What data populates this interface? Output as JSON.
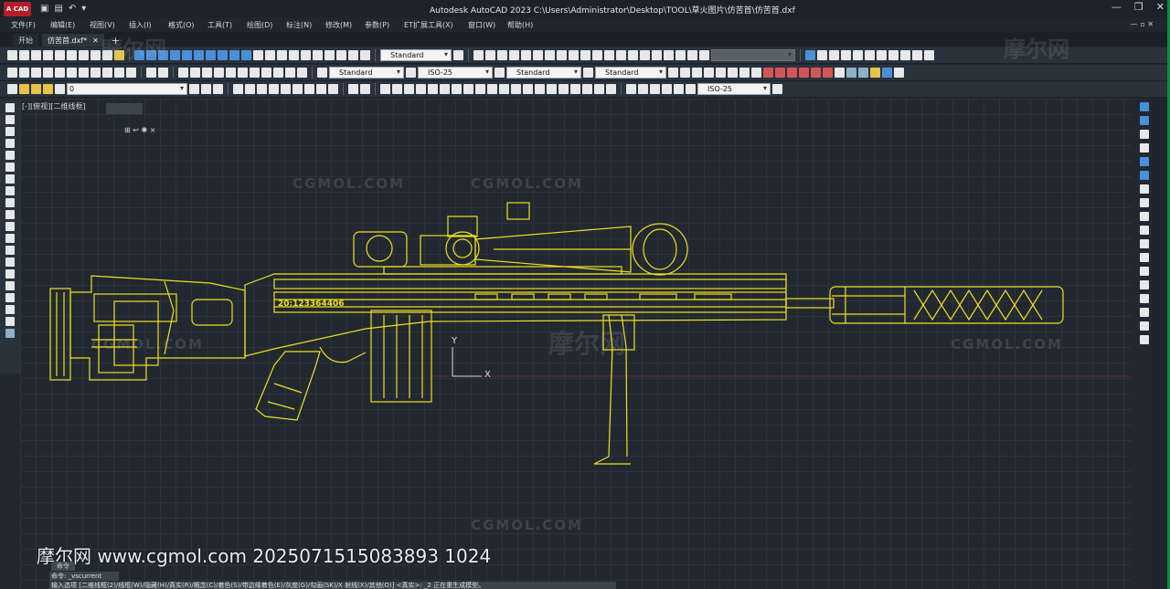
{
  "title_bar": {
    "app_badge": "A CAD",
    "title": "Autodesk AutoCAD 2023    C:\\Users\\Administrator\\Desktop\\TOOL\\草火图片\\仿苦首\\仿苦首.dxf",
    "qat_icons": [
      "open-icon",
      "save-icon",
      "undo-icon",
      "customize-icon"
    ],
    "min_glyph": "—",
    "restore_glyph": "❐",
    "close_glyph": "✕"
  },
  "menu": {
    "items": [
      "文件(F)",
      "编辑(E)",
      "视图(V)",
      "插入(I)",
      "格式(O)",
      "工具(T)",
      "绘图(D)",
      "标注(N)",
      "修改(M)",
      "参数(P)",
      "ET扩展工具(X)",
      "窗口(W)",
      "帮助(H)"
    ],
    "right_glyph": "— ▫ ✕"
  },
  "file_tabs": {
    "items": [
      {
        "label": "开始",
        "close": ""
      },
      {
        "label": "仿苦首.dxf*",
        "close": "✕"
      }
    ],
    "add_glyph": "+"
  },
  "toolbar": {
    "text_style": "Standard",
    "layer_search": "",
    "annot_style": "Standard",
    "dim_style": "ISO-25",
    "table_style": "Standard",
    "multileader_style": "Standard",
    "layer": "0",
    "dim_style2": "ISO-25"
  },
  "viewport": {
    "label": "[-][俯视][二维线框]",
    "nav_glyphs": "⊞ ↩ ✺ ×"
  },
  "drawing": {
    "serial_text": "20:123364406",
    "ucs_x": "X",
    "ucs_y": "Y",
    "line_color": "#f0e020"
  },
  "watermarks": {
    "cgmol": "CGMOL.COM",
    "cn": "摩尔网",
    "footer": "摩尔网 www.cgmol.com 2025071515083893 1024"
  },
  "command": {
    "label": "命令",
    "line1": "命令: _vscurrent",
    "line2": "输入选项 [二维线框(2)/线框(W)/隐藏(H)/真实(R)/概念(C)/着色(S)/带边缘着色(E)/灰度(G)/勾画(SK)/X 射线(X)/其他(O)] <真实>: _2  正在重生成模型。"
  },
  "colors": {
    "canvas_bg": "#212830",
    "wire": "#f0e020",
    "green_edge": "#0c8d3f"
  }
}
